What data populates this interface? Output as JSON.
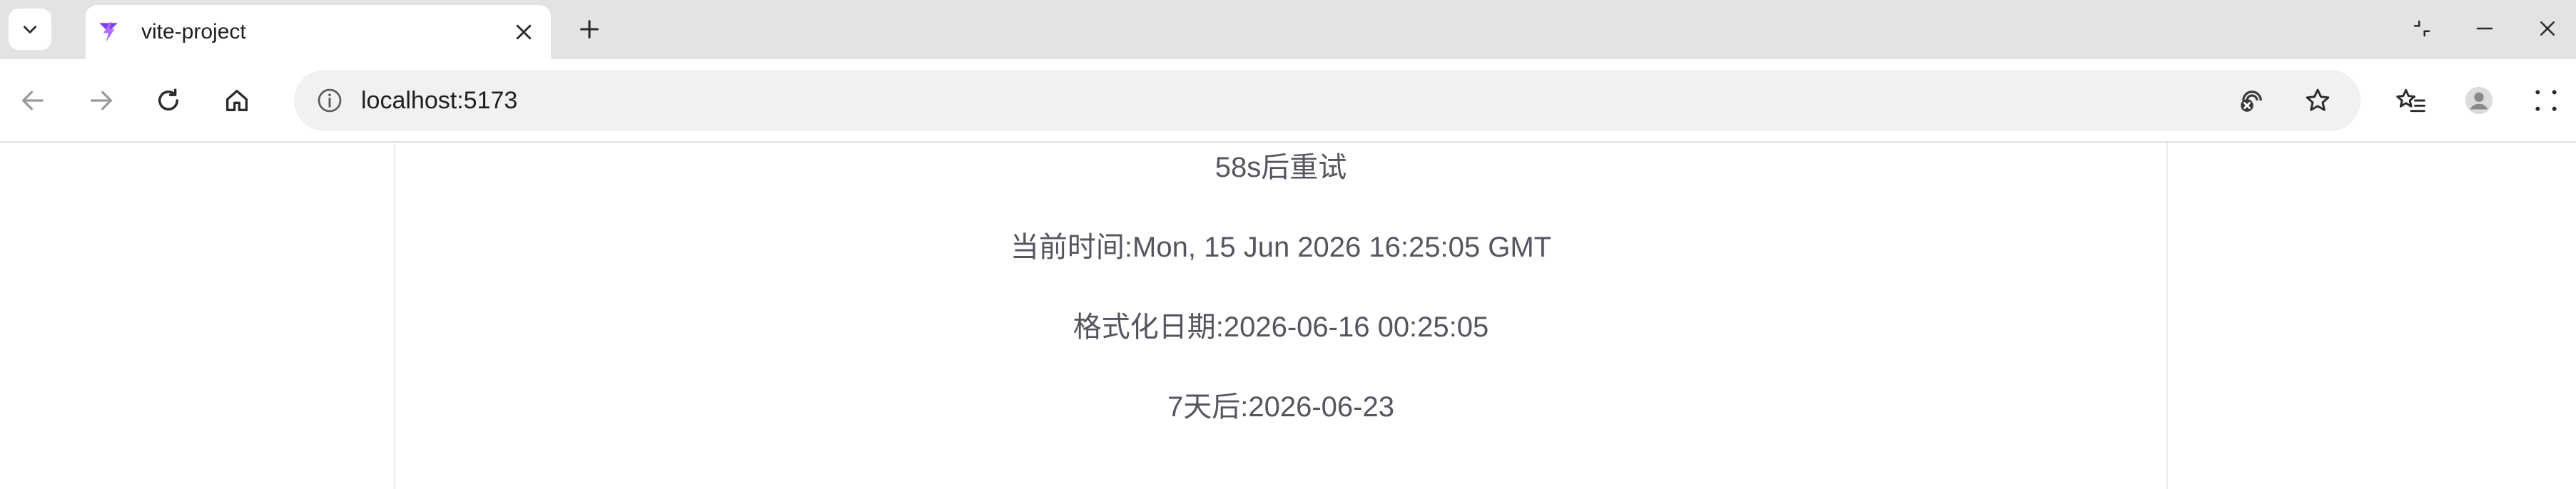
{
  "tab": {
    "title": "vite-project"
  },
  "address_bar": {
    "url": "localhost:5173"
  },
  "page": {
    "retry_text": "58s后重试",
    "current_time_label": "当前时间:",
    "current_time_value": "Mon, 15 Jun 2026 16:25:05 GMT",
    "formatted_date_label": "格式化日期:",
    "formatted_date_value": "2026-06-16 00:25:05",
    "seven_days_label": "7天后:",
    "seven_days_value": "2026-06-23"
  },
  "icons": {
    "tab_list": "chevron-down-icon",
    "favicon": "vite-logo-icon",
    "tab_close": "close-icon",
    "new_tab": "plus-icon",
    "minimize_restore": "restore-icon",
    "minimize": "minimize-icon",
    "close_window": "close-icon",
    "back": "back-arrow-icon",
    "forward": "forward-arrow-icon",
    "reload": "reload-icon",
    "home": "home-icon",
    "site_info": "info-icon",
    "tracking_prevention": "tracking-prevention-icon",
    "favorite": "star-icon",
    "favorites_list": "favorites-list-icon",
    "profile": "profile-icon",
    "menu": "menu-dots-icon"
  },
  "colors": {
    "tabstrip_bg": "#e3e3e3",
    "omnibox_bg": "#f1f1f1",
    "page_text": "#555560",
    "vite_purple": "#9b4dff"
  }
}
